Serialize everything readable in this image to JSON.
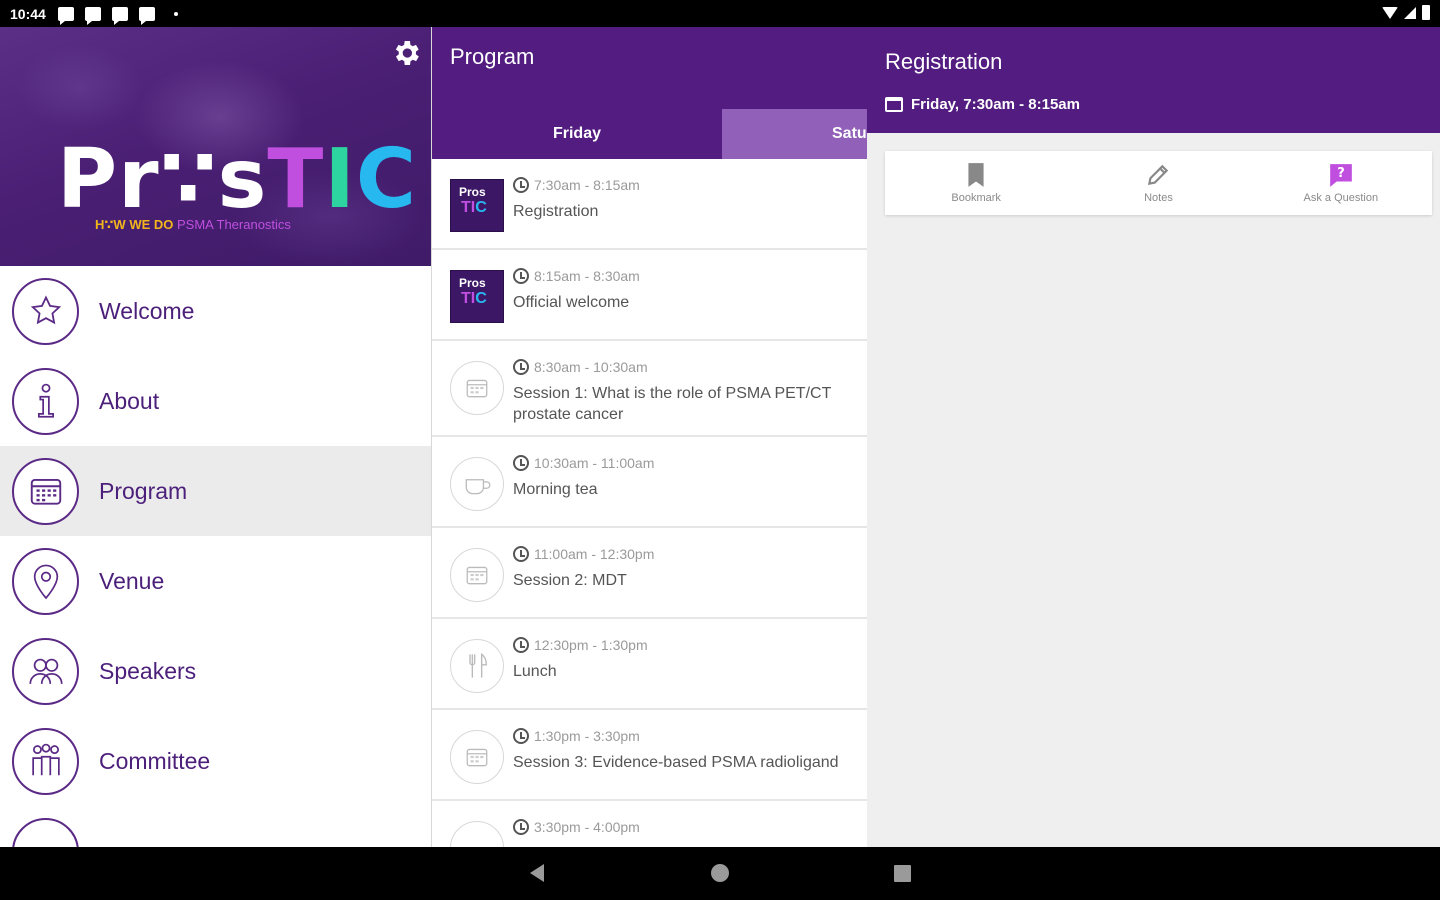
{
  "status_bar": {
    "time": "10:44"
  },
  "drawer": {
    "logo": {
      "pros": "Pr∵s",
      "tic_t": "T",
      "tic_i": "I",
      "tic_c": "C"
    },
    "tagline": {
      "how": "H∵W WE DO",
      "psma": "PSMA Theranostics"
    },
    "items": [
      {
        "label": "Welcome",
        "icon": "star-icon"
      },
      {
        "label": "About",
        "icon": "info-icon"
      },
      {
        "label": "Program",
        "icon": "calendar-icon",
        "active": true
      },
      {
        "label": "Venue",
        "icon": "location-pin-icon"
      },
      {
        "label": "Speakers",
        "icon": "people-icon"
      },
      {
        "label": "Committee",
        "icon": "group-icon"
      }
    ]
  },
  "program": {
    "title": "Program",
    "tabs": [
      "Friday",
      "Satu"
    ],
    "events": [
      {
        "time": "7:30am - 8:15am",
        "title": "Registration",
        "thumb": {
          "line1": "Pros",
          "a": "TI",
          "b": "C"
        }
      },
      {
        "time": "8:15am - 8:30am",
        "title": "Official welcome",
        "thumb": {
          "line1": "Pros",
          "a": "TI",
          "b": "C"
        }
      },
      {
        "time": "8:30am - 10:30am",
        "title": "Session 1: What is the role of PSMA PET/CT prostate cancer",
        "icon": "calendar-icon"
      },
      {
        "time": "10:30am - 11:00am",
        "title": "Morning tea",
        "icon": "cup-icon"
      },
      {
        "time": "11:00am - 12:30pm",
        "title": "Session 2: MDT",
        "icon": "calendar-icon"
      },
      {
        "time": "12:30pm - 1:30pm",
        "title": "Lunch",
        "icon": "cutlery-icon"
      },
      {
        "time": "1:30pm - 3:30pm",
        "title": "Session 3: Evidence-based PSMA radioligand",
        "icon": "calendar-icon"
      },
      {
        "time": "3:30pm - 4:00pm",
        "title": "",
        "icon": "cup-icon"
      }
    ]
  },
  "detail": {
    "title": "Registration",
    "when": "Friday, 7:30am - 8:15am",
    "actions": [
      {
        "label": "Bookmark",
        "icon": "bookmark-icon"
      },
      {
        "label": "Notes",
        "icon": "pencil-icon"
      },
      {
        "label": "Ask a Question",
        "icon": "question-icon"
      }
    ]
  },
  "colors": {
    "header_purple": "#531c80",
    "tab_inactive": "#9160b8",
    "menu_text": "#4b1f7a",
    "accent_magenta": "#c04fe0"
  }
}
